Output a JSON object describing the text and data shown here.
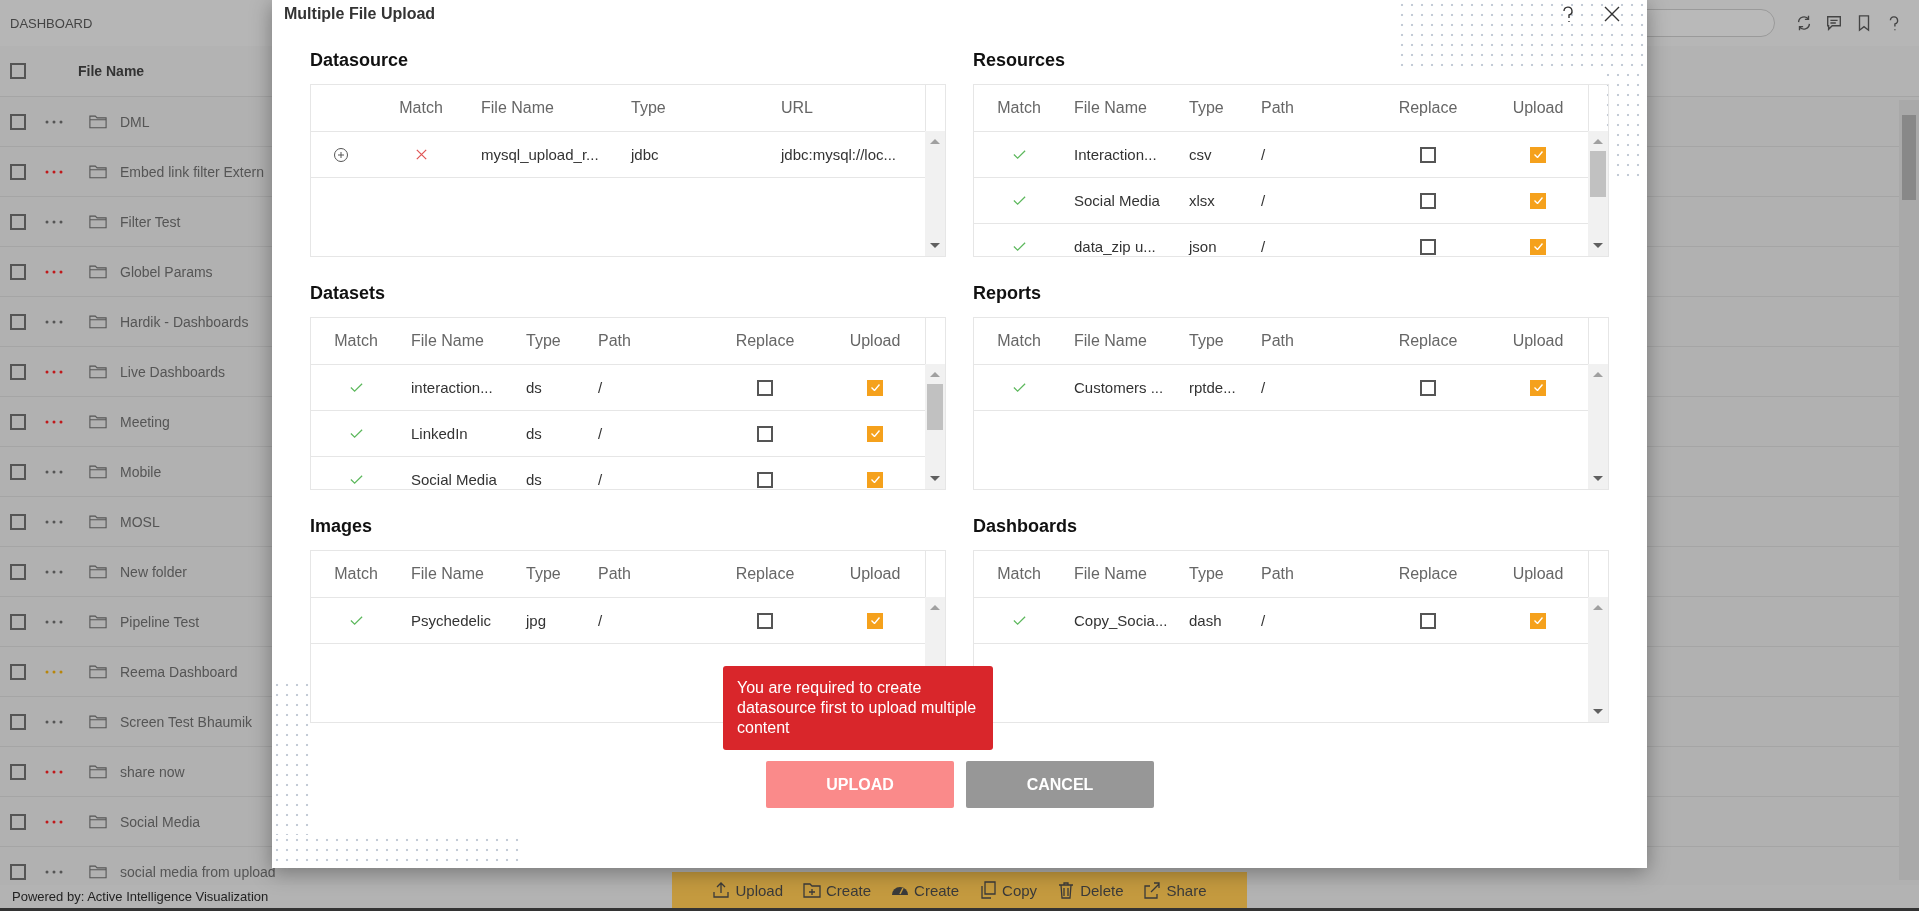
{
  "header": {
    "title": "DASHBOARD"
  },
  "file_list": {
    "column": "File Name",
    "select_all_checked": false,
    "rows": [
      {
        "name": "DML",
        "color": "#555555",
        "checked": false
      },
      {
        "name": "Embed link filter Extern",
        "color": "#c0181b",
        "checked": false
      },
      {
        "name": "Filter Test",
        "color": "#555555",
        "checked": false
      },
      {
        "name": "Globel Params",
        "color": "#c0181b",
        "checked": false
      },
      {
        "name": "Hardik - Dashboards",
        "color": "#555555",
        "checked": false
      },
      {
        "name": "Live Dashboards",
        "color": "#c0181b",
        "checked": false
      },
      {
        "name": "Meeting",
        "color": "#c0181b",
        "checked": false
      },
      {
        "name": "Mobile",
        "color": "#555555",
        "checked": false
      },
      {
        "name": "MOSL",
        "color": "#555555",
        "checked": false
      },
      {
        "name": "New folder",
        "color": "#555555",
        "checked": false
      },
      {
        "name": "Pipeline Test",
        "color": "#555555",
        "checked": false
      },
      {
        "name": "Reema Dashboard",
        "color": "#b8860b",
        "checked": false
      },
      {
        "name": "Screen Test Bhaumik",
        "color": "#555555",
        "checked": false
      },
      {
        "name": "share now",
        "color": "#c0181b",
        "checked": false
      },
      {
        "name": "Social Media",
        "color": "#c0181b",
        "checked": false
      },
      {
        "name": "social media from upload",
        "color": "#555555",
        "checked": false
      }
    ]
  },
  "toolbar": [
    {
      "label": "Upload",
      "kind": "upload"
    },
    {
      "label": "Create",
      "kind": "folder"
    },
    {
      "label": "Create",
      "kind": "dashboard"
    },
    {
      "label": "Copy",
      "kind": "copy"
    },
    {
      "label": "Delete",
      "kind": "delete"
    },
    {
      "label": "Share",
      "kind": "share"
    }
  ],
  "footer": "Powered by: Active Intelligence Visualization",
  "modal": {
    "title": "Multiple File Upload",
    "sections": [
      {
        "title": "Datasource",
        "kind": "datasource",
        "columns": [
          "Match",
          "File Name",
          "Type",
          "URL"
        ],
        "rows": [
          {
            "match": false,
            "name": "mysql_upload_r...",
            "type": "jdbc",
            "url": "jdbc:mysql://loc..."
          }
        ]
      },
      {
        "title": "Resources",
        "kind": "files",
        "columns": [
          "Match",
          "File Name",
          "Type",
          "Path",
          "Replace",
          "Upload"
        ],
        "rows": [
          {
            "match": true,
            "name": "Interaction...",
            "type": "csv",
            "path": "/",
            "replace": false,
            "upload": true
          },
          {
            "match": true,
            "name": "Social Media",
            "type": "xlsx",
            "path": "/",
            "replace": false,
            "upload": true
          },
          {
            "match": true,
            "name": "data_zip u...",
            "type": "json",
            "path": "/",
            "replace": false,
            "upload": true
          }
        ]
      },
      {
        "title": "Datasets",
        "kind": "files",
        "columns": [
          "Match",
          "File Name",
          "Type",
          "Path",
          "Replace",
          "Upload"
        ],
        "rows": [
          {
            "match": true,
            "name": "interaction...",
            "type": "ds",
            "path": "/",
            "replace": false,
            "upload": true
          },
          {
            "match": true,
            "name": "LinkedIn",
            "type": "ds",
            "path": "/",
            "replace": false,
            "upload": true
          },
          {
            "match": true,
            "name": "Social Media",
            "type": "ds",
            "path": "/",
            "replace": false,
            "upload": true
          }
        ]
      },
      {
        "title": "Reports",
        "kind": "files",
        "columns": [
          "Match",
          "File Name",
          "Type",
          "Path",
          "Replace",
          "Upload"
        ],
        "rows": [
          {
            "match": true,
            "name": "Customers ...",
            "type": "rptde...",
            "path": "/",
            "replace": false,
            "upload": true
          }
        ]
      },
      {
        "title": "Images",
        "kind": "files",
        "columns": [
          "Match",
          "File Name",
          "Type",
          "Path",
          "Replace",
          "Upload"
        ],
        "rows": [
          {
            "match": true,
            "name": "Psychedelic",
            "type": "jpg",
            "path": "/",
            "replace": false,
            "upload": true
          }
        ]
      },
      {
        "title": "Dashboards",
        "kind": "files",
        "columns": [
          "Match",
          "File Name",
          "Type",
          "Path",
          "Replace",
          "Upload"
        ],
        "rows": [
          {
            "match": true,
            "name": "Copy_Socia...",
            "type": "dash",
            "path": "/",
            "replace": false,
            "upload": true
          }
        ]
      }
    ],
    "toast": "You are required to create datasource first to upload multiple content",
    "buttons": [
      {
        "label": "UPLOAD",
        "kind": "primary",
        "disabled": true
      },
      {
        "label": "CANCEL",
        "kind": "secondary",
        "disabled": false
      }
    ]
  }
}
